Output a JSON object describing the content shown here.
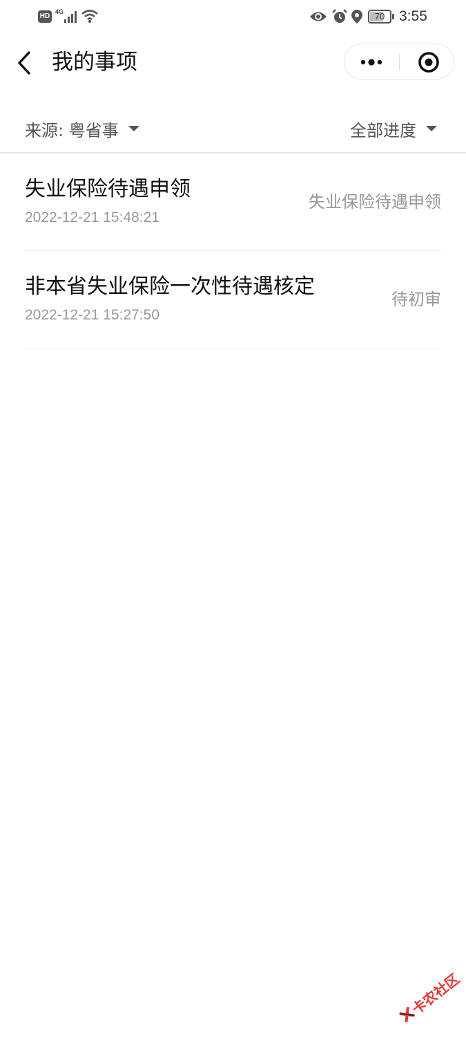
{
  "status_bar": {
    "hd_label": "HD",
    "network": "4G",
    "battery_level": "70",
    "battery_fraction": 0.7,
    "time": "3:55",
    "icons": [
      "signal-icon",
      "wifi-icon",
      "eye-icon",
      "alarm-icon",
      "location-icon",
      "battery-icon"
    ]
  },
  "nav": {
    "title": "我的事项",
    "back_icon": "chevron-left-icon",
    "more_icon": "more-dots-icon",
    "close_icon": "target-circle-icon"
  },
  "filters": {
    "source_label": "来源: 粤省事",
    "progress_label": "全部进度"
  },
  "items": [
    {
      "title": "失业保险待遇申领",
      "time": "2022-12-21 15:48:21",
      "status": "失业保险待遇申领"
    },
    {
      "title": "非本省失业保险一次性待遇核定",
      "time": "2022-12-21 15:27:50",
      "status": "待初审"
    }
  ],
  "watermark": {
    "text": "卡农社区"
  },
  "colors": {
    "text_primary": "#111111",
    "text_secondary": "#999999",
    "divider": "#e6e6e6",
    "watermark": "#e53935"
  }
}
